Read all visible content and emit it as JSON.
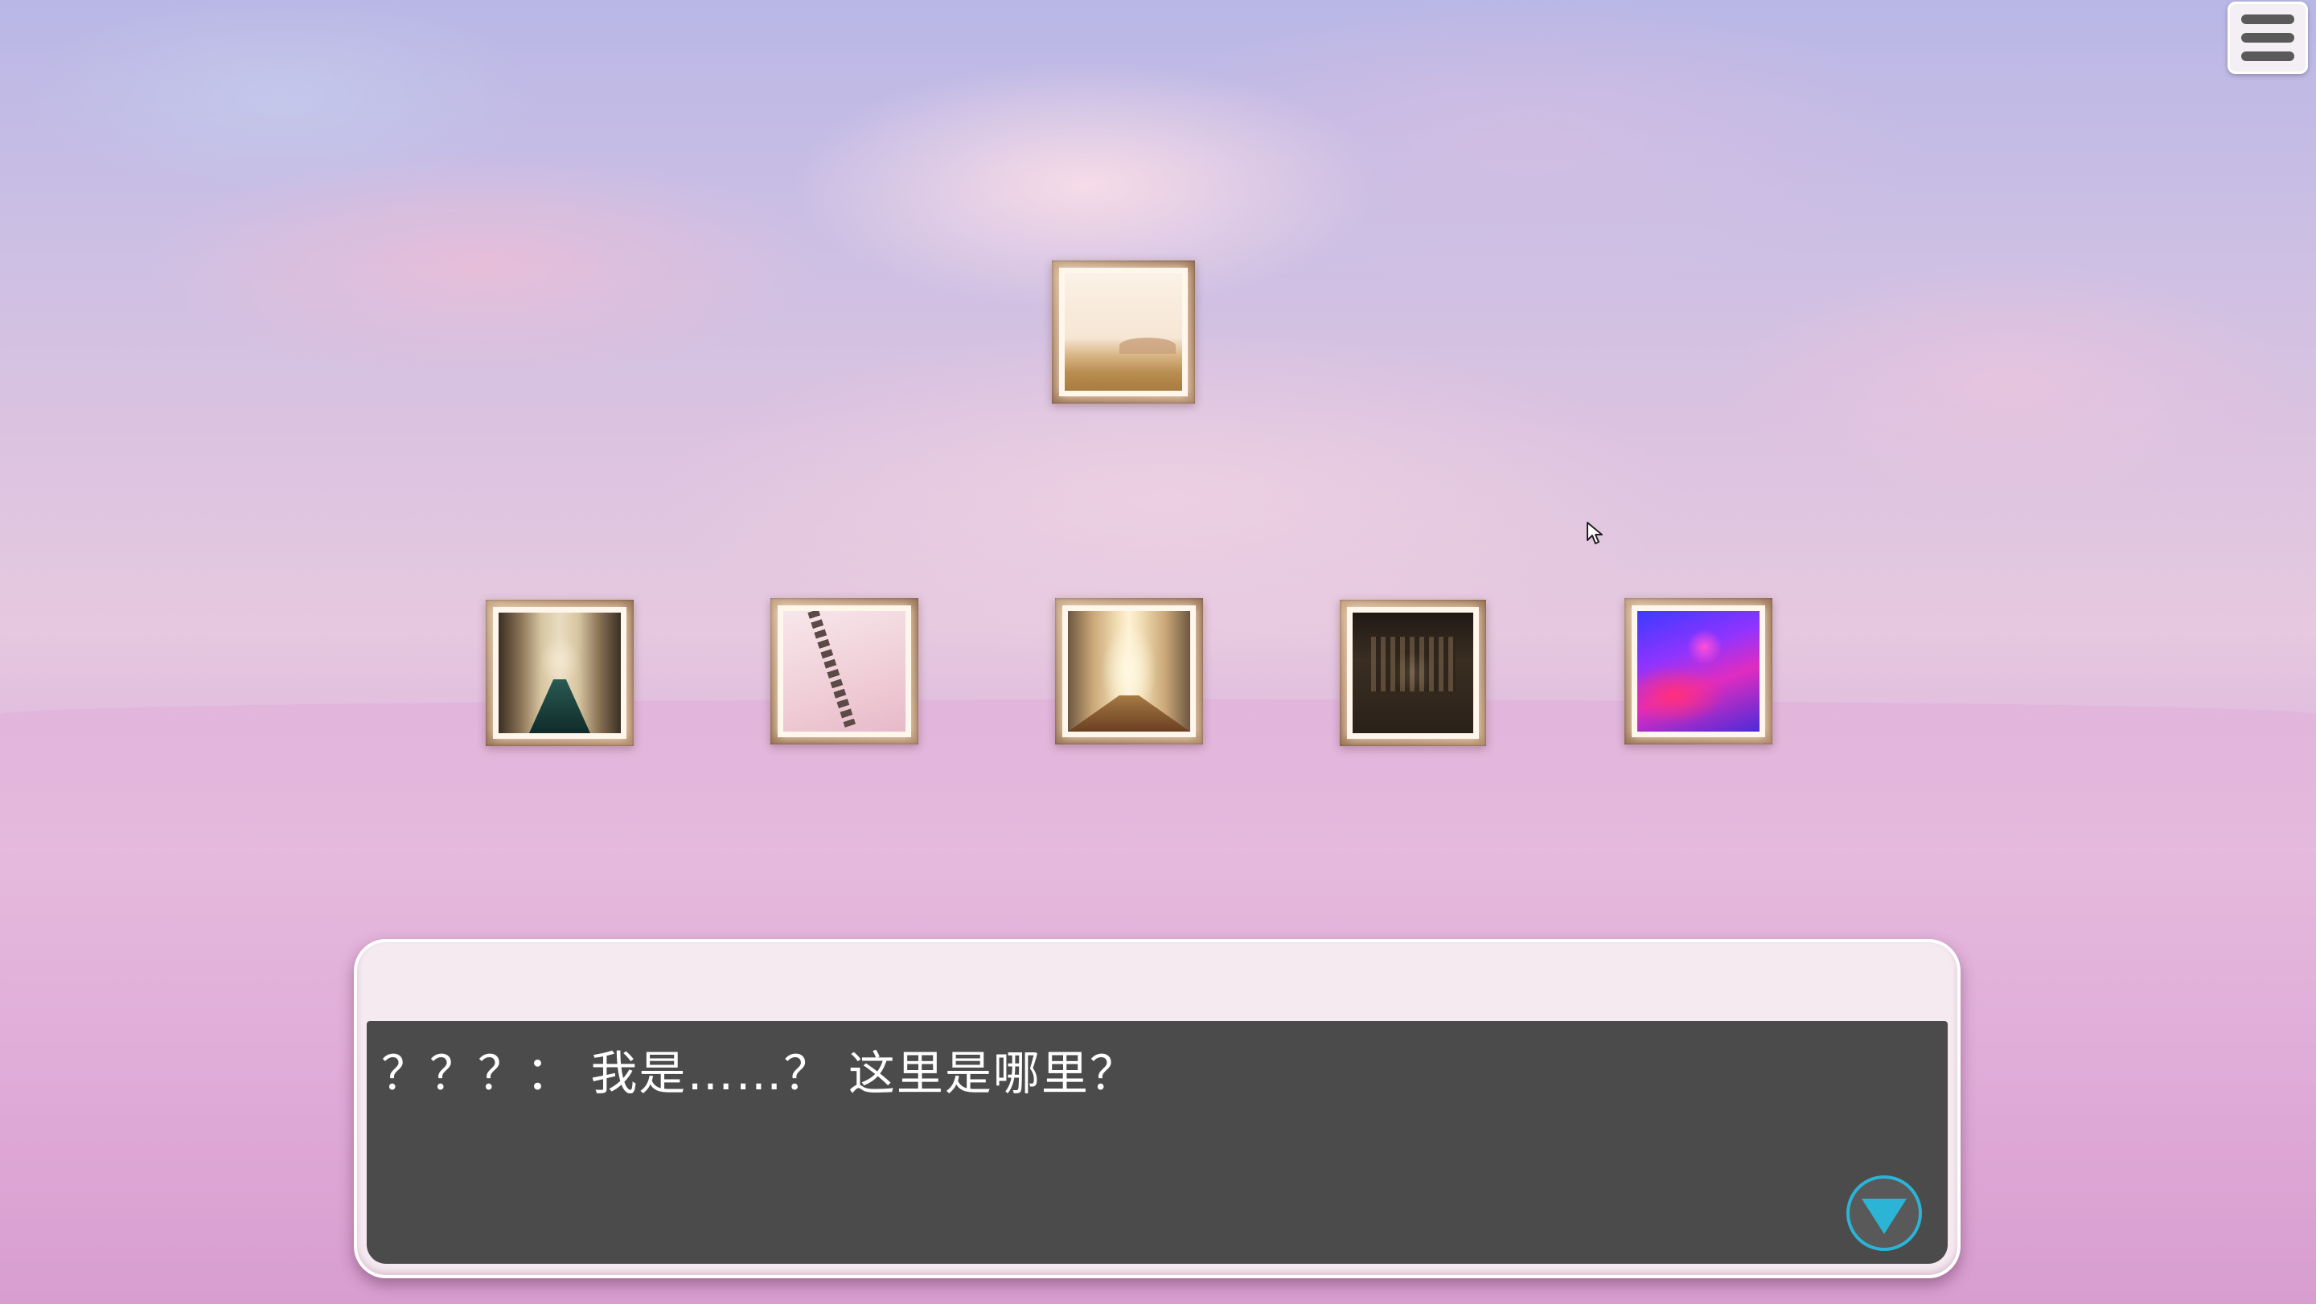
{
  "menu": {
    "icon": "hamburger-menu-icon"
  },
  "paintings": [
    {
      "name": "painting-landscape",
      "subject": "sunlit-landscape"
    },
    {
      "name": "painting-hall",
      "subject": "palace-hall"
    },
    {
      "name": "painting-chains",
      "subject": "hanging-chains"
    },
    {
      "name": "painting-corridor",
      "subject": "golden-corridor"
    },
    {
      "name": "painting-library",
      "subject": "dark-library"
    },
    {
      "name": "painting-neon",
      "subject": "neon-room"
    }
  ],
  "dialog": {
    "speaker": "",
    "text": "？？？： 我是……？ 这里是哪里？",
    "advance_icon": "triangle-down-icon"
  },
  "colors": {
    "dialog_body": "#4b4b4b",
    "dialog_frame": "#f6eaf1",
    "accent": "#2bb4d6",
    "frame_wood": "#b58f70"
  }
}
